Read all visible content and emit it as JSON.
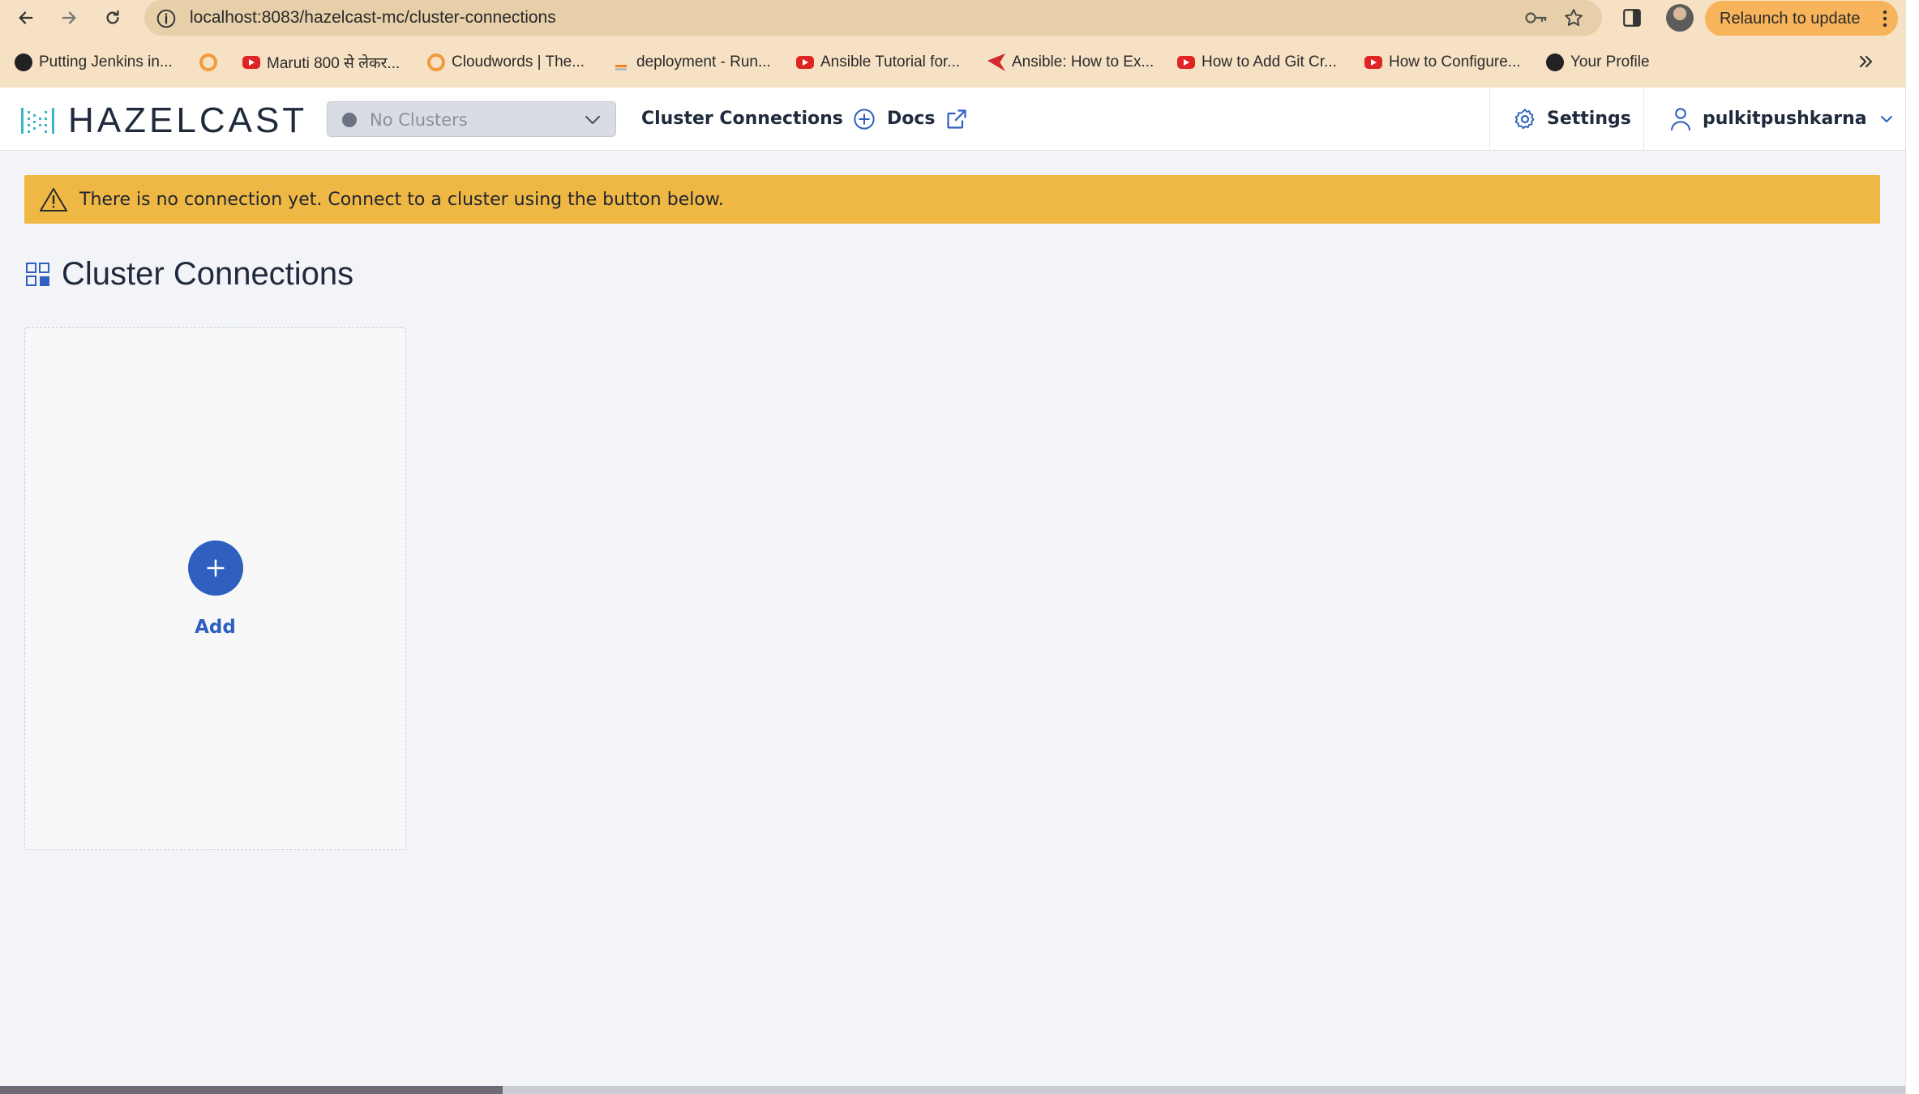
{
  "browser": {
    "url": "localhost:8083/hazelcast-mc/cluster-connections",
    "relaunch_label": "Relaunch to update",
    "bookmarks": [
      {
        "label": "Putting Jenkins in...",
        "icon": "jenkins-icon"
      },
      {
        "label": "",
        "icon": "swirl-icon"
      },
      {
        "label": "Maruti 800 से लेकर...",
        "icon": "youtube-icon"
      },
      {
        "label": "Cloudwords | The...",
        "icon": "swirl-icon"
      },
      {
        "label": "deployment - Run...",
        "icon": "stackoverflow-icon"
      },
      {
        "label": "Ansible Tutorial for...",
        "icon": "youtube-icon"
      },
      {
        "label": "Ansible: How to Ex...",
        "icon": "ansible-icon"
      },
      {
        "label": "How to Add Git Cr...",
        "icon": "youtube-icon"
      },
      {
        "label": "How to Configure...",
        "icon": "youtube-icon"
      },
      {
        "label": "Your Profile",
        "icon": "github-icon"
      }
    ]
  },
  "header": {
    "logo_text": "HAZELCAST",
    "cluster_select": {
      "value": "No Clusters"
    },
    "nav": {
      "cluster_connections": "Cluster Connections",
      "docs": "Docs",
      "settings": "Settings",
      "user": "pulkitpushkarna"
    }
  },
  "alert": {
    "message": "There is no connection yet. Connect to a cluster using the button below.",
    "color": "#efb844"
  },
  "main": {
    "title": "Cluster Connections",
    "add_label": "Add"
  },
  "colors": {
    "accent": "#2f5fbf",
    "toolbar": "#f7e1c4",
    "relaunch": "#f7b45a"
  }
}
